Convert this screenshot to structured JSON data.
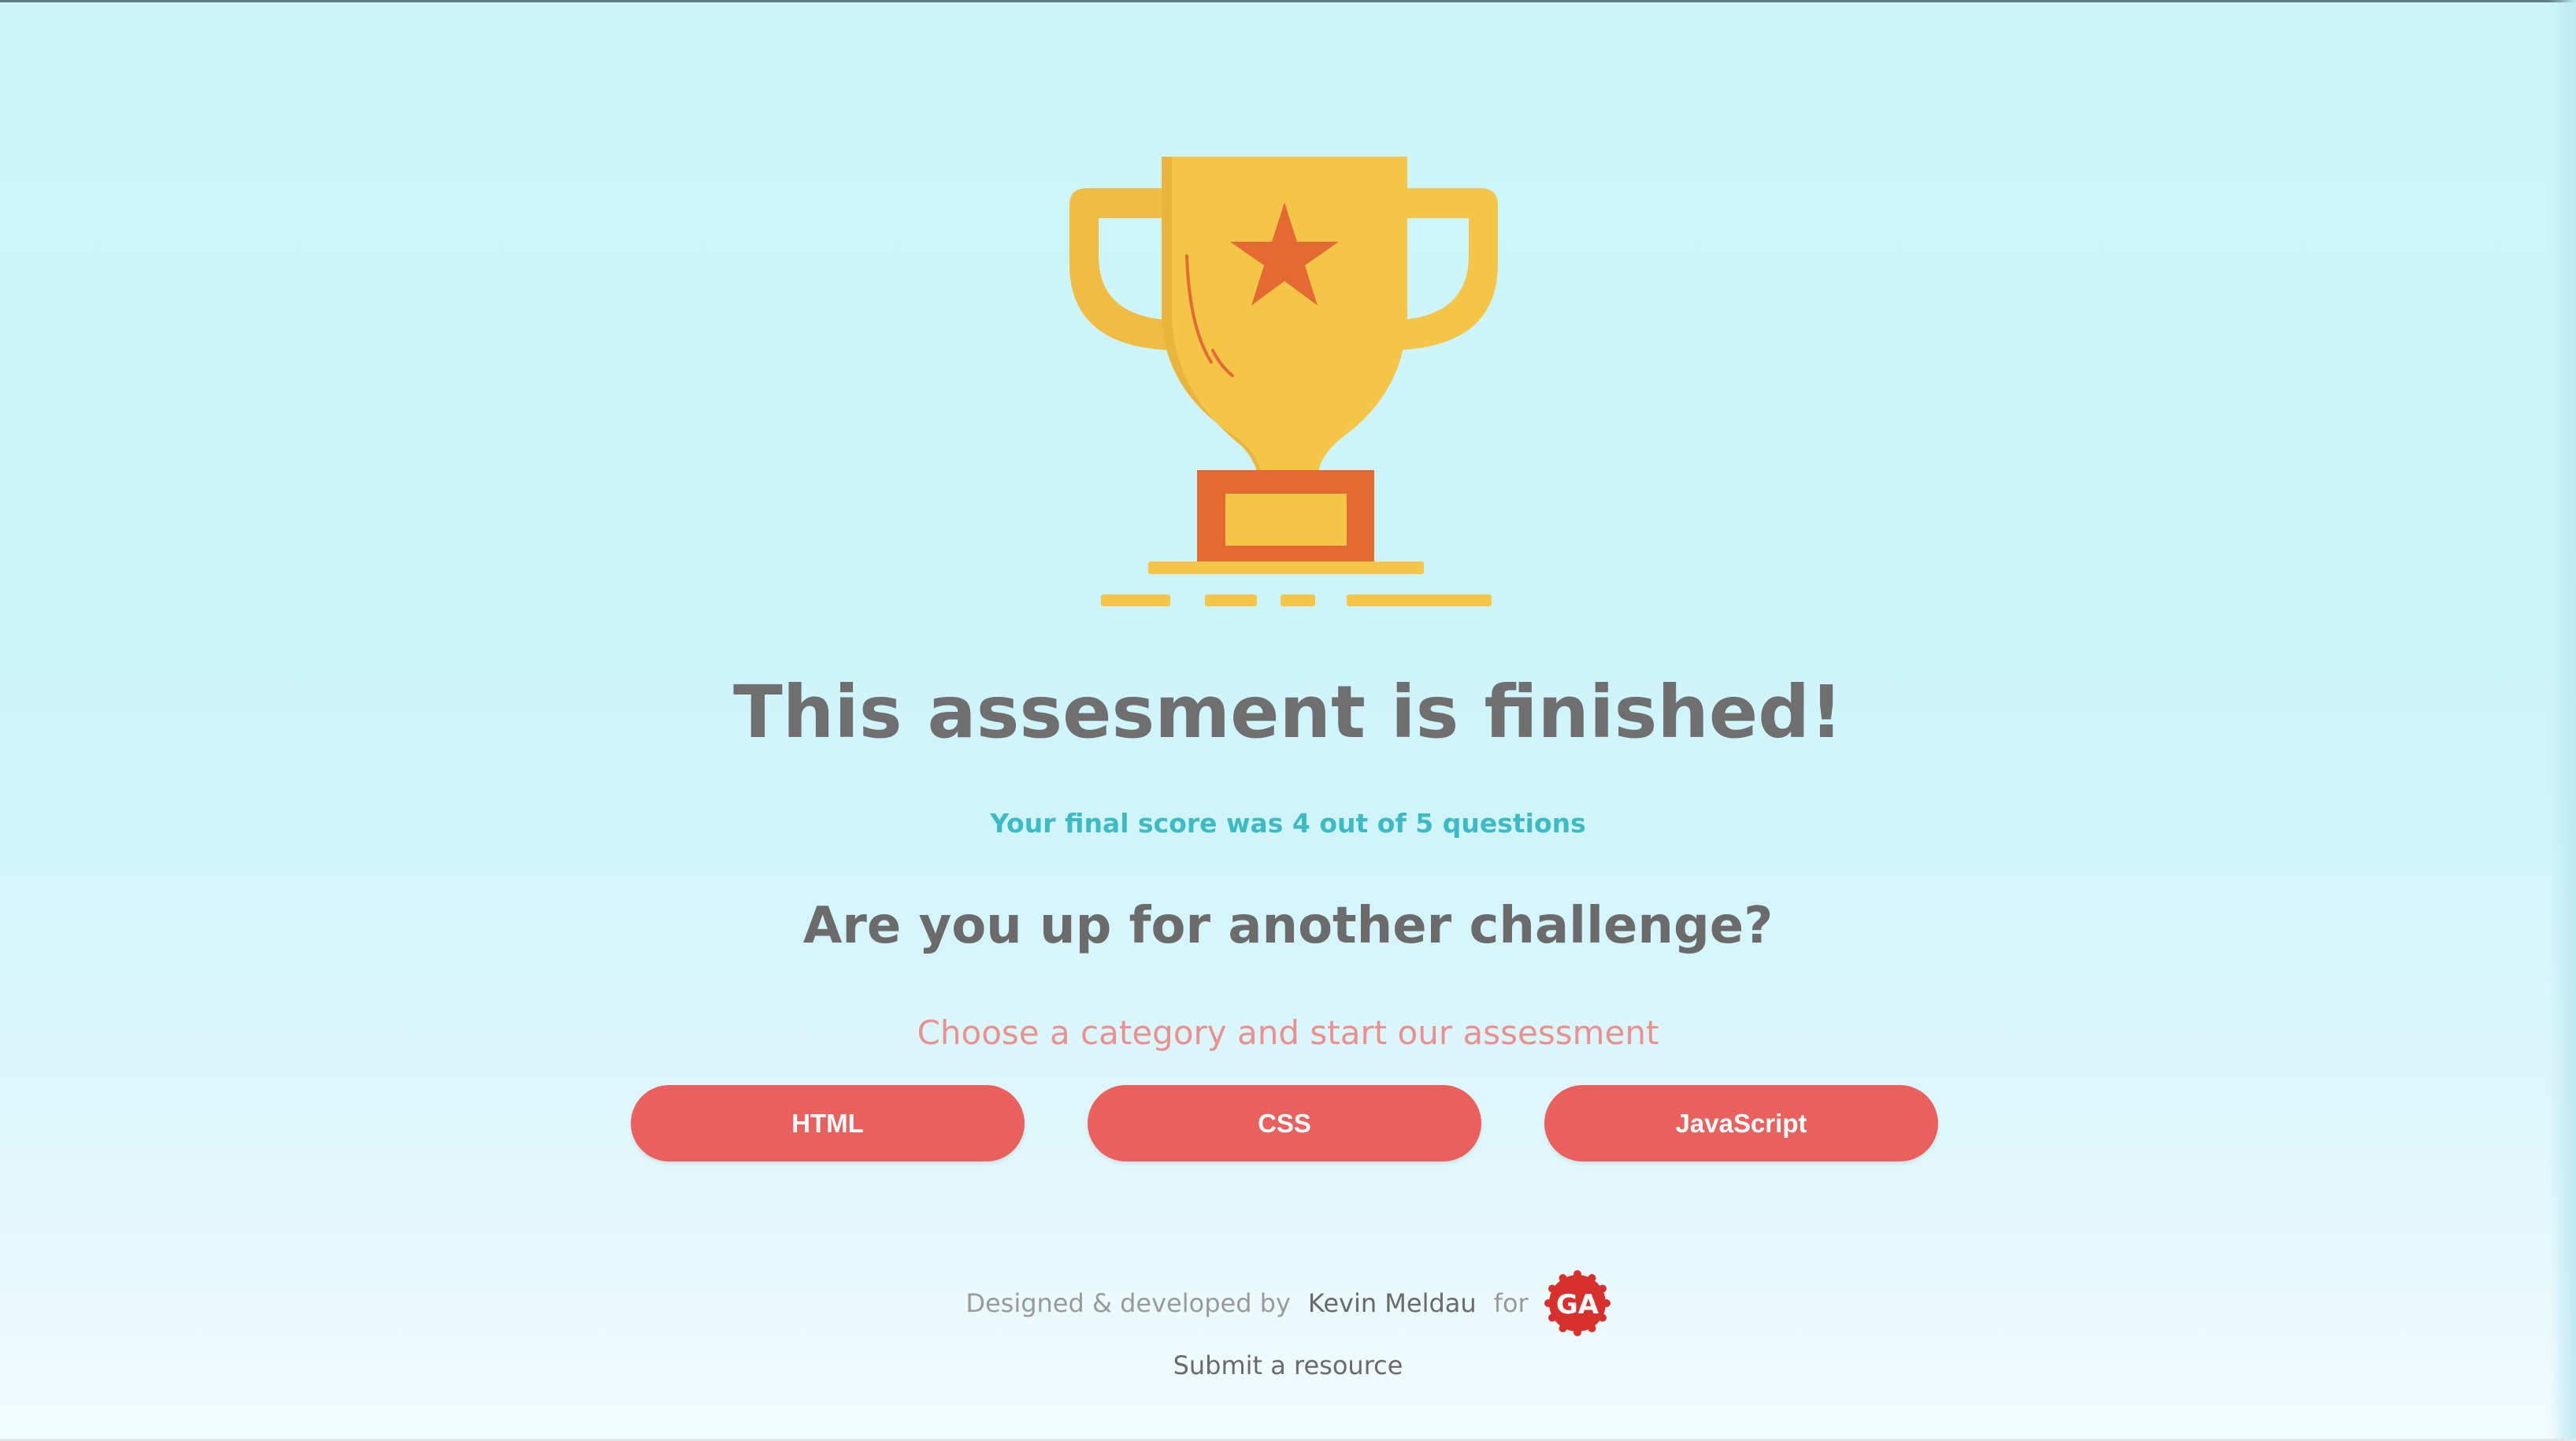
{
  "result": {
    "title": "This assesment is finished!",
    "score_text": "Your final score was 4 out of 5 questions"
  },
  "prompt": {
    "heading": "Are you up for another challenge?",
    "subheading": "Choose a category and start our assessment"
  },
  "categories": [
    {
      "label": "HTML"
    },
    {
      "label": "CSS"
    },
    {
      "label": "JavaScript"
    }
  ],
  "footer": {
    "designed_text": "Designed & developed by",
    "author": "Kevin Meldau",
    "for_text": "for",
    "logo_text": "GA",
    "submit_link": "Submit a resource"
  },
  "icons": {
    "trophy": "trophy-icon",
    "logo": "general-assembly-logo"
  },
  "colors": {
    "background": "#ccf5fb",
    "trophy_gold": "#f5c547",
    "trophy_orange": "#e36a33",
    "title_gray": "#6f6f6f",
    "score_teal": "#3dbbc4",
    "subheading_pink": "#ec8f8f",
    "button_red": "#e9605d",
    "logo_red": "#d8312d"
  }
}
